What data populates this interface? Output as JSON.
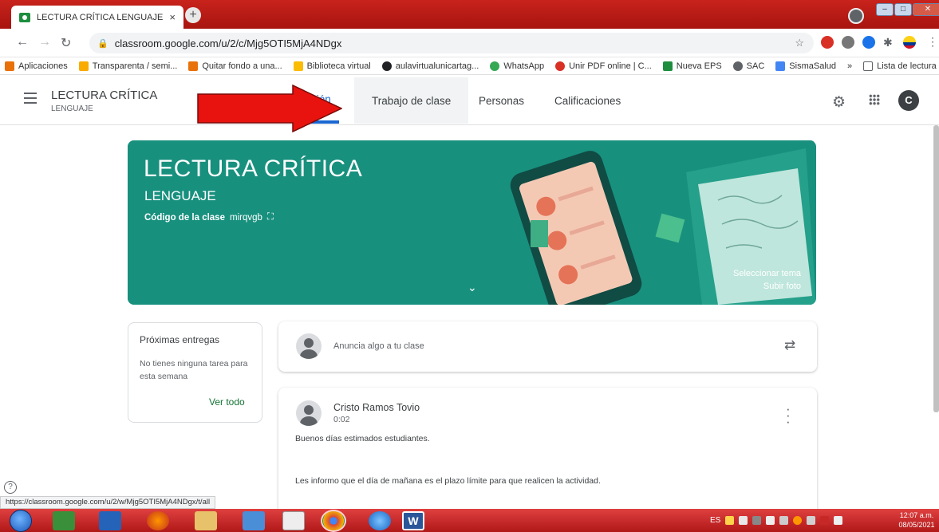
{
  "browser": {
    "tab_title": "LECTURA CRÍTICA LENGUAJE",
    "tab_close": "×",
    "new_tab": "+",
    "url": "classroom.google.com/u/2/c/Mjg5OTI5MjA4NDgx",
    "status_url": "https://classroom.google.com/u/2/w/Mjg5OTI5MjA4NDgx/t/all",
    "bookmarks": [
      {
        "label": "Aplicaciones",
        "color": "#e8710a"
      },
      {
        "label": "Transparenta / semi...",
        "color": "#f9ab00"
      },
      {
        "label": "Quitar fondo a una...",
        "color": "#e8710a"
      },
      {
        "label": "Biblioteca virtual",
        "color": "#fbbc04"
      },
      {
        "label": "aulavirtualunicartag...",
        "color": "#202124"
      },
      {
        "label": "WhatsApp",
        "color": "#34a853"
      },
      {
        "label": "Unir PDF online | C...",
        "color": "#d93025"
      },
      {
        "label": "Nueva EPS",
        "color": "#1e8e3e"
      },
      {
        "label": "SAC",
        "color": "#5f6368"
      },
      {
        "label": "SismaSalud",
        "color": "#4285f4"
      },
      {
        "label": "»",
        "color": ""
      },
      {
        "label": "Lista de lectura",
        "color": "#5f6368"
      }
    ]
  },
  "header": {
    "course_title": "LECTURA CRÍTICA",
    "course_subtitle": "LENGUAJE",
    "tabs": [
      {
        "label": "ción"
      },
      {
        "label": "Trabajo de clase"
      },
      {
        "label": "Personas"
      },
      {
        "label": "Calificaciones"
      }
    ],
    "avatar_letter": "C"
  },
  "banner": {
    "title": "LECTURA CRÍTICA",
    "subtitle": "LENGUAJE",
    "code_label": "Código de la clase",
    "code_value": "mirqvgb",
    "select_theme": "Seleccionar tema",
    "upload_photo": "Subir foto",
    "color": "#18907e"
  },
  "upcoming": {
    "title": "Próximas entregas",
    "text": "No tienes ninguna tarea para esta semana",
    "link": "Ver todo"
  },
  "announce": {
    "placeholder": "Anuncia algo a tu clase"
  },
  "post": {
    "author": "Cristo Ramos Tovio",
    "time": "0:02",
    "line1": "Buenos días estimados estudiantes.",
    "line2": "Les informo que el día de mañana es el plazo límite para que realicen la actividad."
  },
  "taskbar": {
    "lang": "ES",
    "time": "12:07 a.m.",
    "date": "08/05/2021"
  }
}
